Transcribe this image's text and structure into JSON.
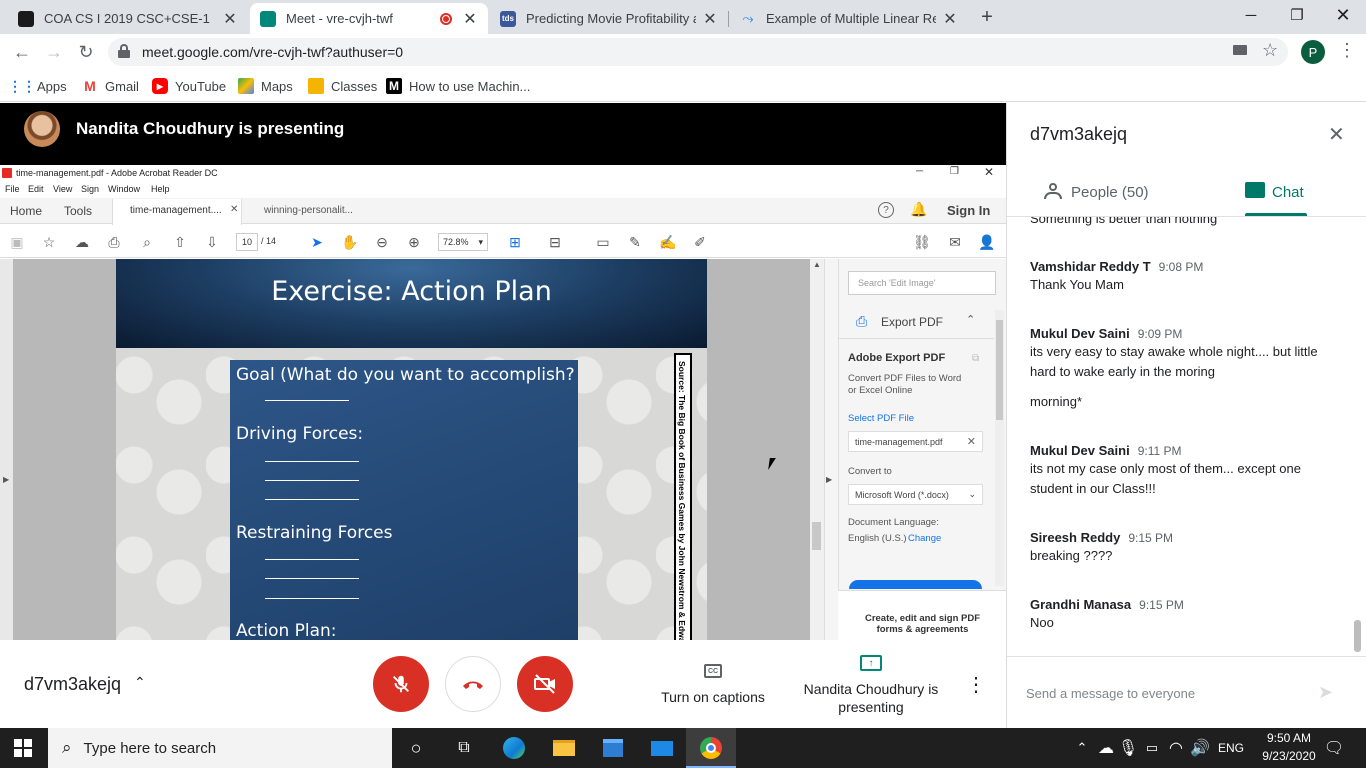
{
  "browser": {
    "tabs": [
      {
        "title": "COA CS I 2019 CSC+CSE-1",
        "color": "#1a1a1a"
      },
      {
        "title": "Meet - vre-cvjh-twf",
        "color": "#00897b"
      },
      {
        "title": "Predicting Movie Profitability and",
        "color": "#3b5998"
      },
      {
        "title": "Example of Multiple Linear Regre",
        "color": "#1e88e5"
      }
    ],
    "new_tab": "+",
    "url": "meet.google.com/vre-cvjh-twf?authuser=0",
    "profile_initial": "P",
    "bookmarks": [
      {
        "label": "Apps"
      },
      {
        "label": "Gmail"
      },
      {
        "label": "YouTube"
      },
      {
        "label": "Maps"
      },
      {
        "label": "Classes"
      },
      {
        "label": "How to use Machin..."
      }
    ]
  },
  "presentation": {
    "presenter_banner": "Nandita Choudhury is presenting",
    "acrobat": {
      "window_title": "time-management.pdf - Adobe Acrobat Reader DC",
      "menu": [
        "File",
        "Edit",
        "View",
        "Sign",
        "Window",
        "Help"
      ],
      "tabs": [
        "Home",
        "Tools",
        "time-management....",
        "winning-personalit..."
      ],
      "sign_in": "Sign In",
      "page_current": "10",
      "page_total": "/ 14",
      "zoom": "72.8%",
      "slide": {
        "title": "Exercise: Action Plan",
        "goal": "Goal (What do you want to accomplish?",
        "driving": "Driving Forces:",
        "restraining": "Restraining Forces",
        "action": "Action Plan:",
        "source": "Source: The Big Book of Business Games by John Newstrom & Edward Sca"
      },
      "right_panel": {
        "search_placeholder": "Search 'Edit Image'",
        "export_pdf": "Export PDF",
        "adobe_export": "Adobe Export PDF",
        "convert_desc": "Convert PDF Files to Word or Excel Online",
        "select_file": "Select PDF File",
        "file_name": "time-management.pdf",
        "convert_to": "Convert to",
        "format": "Microsoft Word (*.docx)",
        "doc_language": "Document Language:",
        "language": "English (U.S.)",
        "change": "Change",
        "promo": "Create, edit and sign PDF forms & agreements"
      }
    }
  },
  "meeting_bar": {
    "meeting_code": "d7vm3akejq",
    "captions_label": "Turn on captions",
    "presenting_label": "Nandita Choudhury is presenting"
  },
  "chat": {
    "header": "d7vm3akejq",
    "people_tab": "People (50)",
    "chat_tab": "Chat",
    "partial_message": "Something is better than nothing",
    "messages": [
      {
        "name": "Vamshidar Reddy T",
        "time": "9:08 PM",
        "lines": [
          "Thank You Mam"
        ]
      },
      {
        "name": "Mukul Dev Saini",
        "time": "9:09 PM",
        "lines": [
          "its very easy to stay awake whole night.... but little hard to wake early in the moring",
          "morning*"
        ]
      },
      {
        "name": "Mukul Dev Saini",
        "time": "9:11 PM",
        "lines": [
          "its not my case only most of them... except one student in our Class!!!"
        ]
      },
      {
        "name": "Sireesh Reddy",
        "time": "9:15 PM",
        "lines": [
          "breaking ????"
        ]
      },
      {
        "name": "Grandhi Manasa",
        "time": "9:15 PM",
        "lines": [
          "Noo"
        ]
      }
    ],
    "input_placeholder": "Send a message to everyone"
  },
  "taskbar": {
    "search_placeholder": "Type here to search",
    "language": "ENG",
    "time": "9:50 AM",
    "date": "9/23/2020"
  }
}
